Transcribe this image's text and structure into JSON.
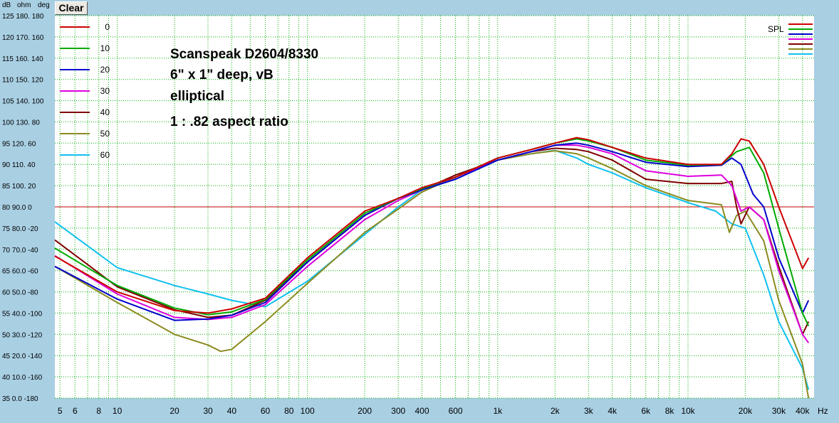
{
  "toolbar": {
    "clear_label": "Clear"
  },
  "header": {
    "unit_db": "dB",
    "unit_ohm": "ohm",
    "unit_deg": "deg"
  },
  "legend_tag": "SPL",
  "x_unit": "Hz",
  "annotation": [
    "Scanspeak D2604/8330",
    "6\" x 1\" deep, vB",
    "elliptical",
    "1 : .82 aspect ratio"
  ],
  "colors": {
    "background": "#ffffff",
    "grid": "#00b000",
    "ref_line": "#c00000",
    "frame": "#a9cfe3"
  },
  "chart_data": {
    "type": "line",
    "x_scale": "log",
    "xlim": [
      4.7,
      46000
    ],
    "ylim": [
      35,
      125
    ],
    "grid": true,
    "legend_position": "top-left",
    "x_tick_labels": [
      "5",
      "6",
      "8",
      "10",
      "20",
      "30",
      "40",
      "60",
      "80",
      "100",
      "200",
      "300",
      "400",
      "600",
      "1k",
      "2k",
      "3k",
      "4k",
      "6k",
      "8k",
      "10k",
      "20k",
      "30k",
      "40k"
    ],
    "y_tick_labels": [
      "125 180. 180",
      "120 170. 160",
      "115 160. 140",
      "110 150. 120",
      "105 140. 100",
      "100 130. 80",
      "95 120. 60",
      "90 110. 40",
      "85 100. 20",
      "80 90.0 0",
      "75 80.0 -20",
      "70 70.0 -40",
      "65 60.0 -60",
      "60 50.0 -80",
      "55 40.0 -100",
      "50 30.0 -120",
      "45 20.0 -140",
      "40 10.0 -160",
      "35 0.0 -180"
    ],
    "reference_line_db": 80,
    "series": [
      {
        "name": "0",
        "color": "#cc0000",
        "points": [
          [
            4.7,
            68.4
          ],
          [
            10,
            60
          ],
          [
            20,
            55.6
          ],
          [
            30,
            55
          ],
          [
            40,
            56
          ],
          [
            60,
            58.5
          ],
          [
            100,
            68
          ],
          [
            200,
            79
          ],
          [
            300,
            82
          ],
          [
            400,
            84.5
          ],
          [
            600,
            87
          ],
          [
            1000,
            91.5
          ],
          [
            1500,
            93.5
          ],
          [
            2000,
            95
          ],
          [
            2600,
            96.3
          ],
          [
            3000,
            95.8
          ],
          [
            4000,
            94
          ],
          [
            6000,
            91.5
          ],
          [
            10000,
            90
          ],
          [
            15000,
            90
          ],
          [
            17000,
            92.5
          ],
          [
            19000,
            96
          ],
          [
            21000,
            95.5
          ],
          [
            25000,
            90
          ],
          [
            30000,
            80
          ],
          [
            40000,
            65.5
          ],
          [
            43000,
            68
          ]
        ]
      },
      {
        "name": "10",
        "color": "#00aa00",
        "points": [
          [
            4.7,
            70.3
          ],
          [
            10,
            61.5
          ],
          [
            20,
            56.2
          ],
          [
            30,
            54.6
          ],
          [
            40,
            55.3
          ],
          [
            60,
            58.2
          ],
          [
            100,
            67.5
          ],
          [
            200,
            78.5
          ],
          [
            300,
            82
          ],
          [
            400,
            84.3
          ],
          [
            600,
            87
          ],
          [
            1000,
            91.5
          ],
          [
            1500,
            93.5
          ],
          [
            2000,
            95
          ],
          [
            2600,
            96
          ],
          [
            3000,
            95.5
          ],
          [
            4000,
            94
          ],
          [
            6000,
            91
          ],
          [
            10000,
            89.8
          ],
          [
            15000,
            90
          ],
          [
            18000,
            93
          ],
          [
            21000,
            94
          ],
          [
            25000,
            88
          ],
          [
            30000,
            75
          ],
          [
            40000,
            55
          ],
          [
            43000,
            52
          ]
        ]
      },
      {
        "name": "20",
        "color": "#0000cc",
        "points": [
          [
            4.7,
            66
          ],
          [
            10,
            58.3
          ],
          [
            20,
            53.3
          ],
          [
            30,
            53.6
          ],
          [
            40,
            54.5
          ],
          [
            60,
            57.5
          ],
          [
            100,
            67
          ],
          [
            200,
            78
          ],
          [
            300,
            82
          ],
          [
            400,
            84
          ],
          [
            600,
            86.5
          ],
          [
            1000,
            91
          ],
          [
            1500,
            93
          ],
          [
            2000,
            94.5
          ],
          [
            2600,
            95
          ],
          [
            3000,
            94.5
          ],
          [
            4000,
            93
          ],
          [
            6000,
            90.5
          ],
          [
            10000,
            89.5
          ],
          [
            15000,
            89.8
          ],
          [
            17000,
            91.5
          ],
          [
            19000,
            90
          ],
          [
            22000,
            83
          ],
          [
            25000,
            80
          ],
          [
            30000,
            68
          ],
          [
            40000,
            55
          ],
          [
            43000,
            58
          ]
        ]
      },
      {
        "name": "30",
        "color": "#dd00dd",
        "points": [
          [
            4.7,
            68.5
          ],
          [
            10,
            59.5
          ],
          [
            20,
            54
          ],
          [
            30,
            53.5
          ],
          [
            40,
            54
          ],
          [
            60,
            57
          ],
          [
            100,
            66
          ],
          [
            200,
            77
          ],
          [
            300,
            81.5
          ],
          [
            400,
            84
          ],
          [
            600,
            87
          ],
          [
            1000,
            91
          ],
          [
            1500,
            93
          ],
          [
            2000,
            94.5
          ],
          [
            2600,
            94.5
          ],
          [
            3000,
            94
          ],
          [
            4000,
            92.5
          ],
          [
            6000,
            88.5
          ],
          [
            10000,
            87.2
          ],
          [
            15000,
            87.5
          ],
          [
            17000,
            85
          ],
          [
            19000,
            79
          ],
          [
            21000,
            80
          ],
          [
            25000,
            77
          ],
          [
            30000,
            65
          ],
          [
            40000,
            50
          ],
          [
            43000,
            48
          ]
        ]
      },
      {
        "name": "40",
        "color": "#800000",
        "points": [
          [
            4.7,
            72.2
          ],
          [
            10,
            61.2
          ],
          [
            20,
            55.8
          ],
          [
            30,
            54
          ],
          [
            40,
            54.5
          ],
          [
            60,
            58
          ],
          [
            100,
            67
          ],
          [
            200,
            78
          ],
          [
            300,
            82
          ],
          [
            400,
            84
          ],
          [
            600,
            87.5
          ],
          [
            1000,
            91
          ],
          [
            1500,
            93
          ],
          [
            2000,
            93.8
          ],
          [
            2600,
            93.5
          ],
          [
            3000,
            93
          ],
          [
            4000,
            91
          ],
          [
            6000,
            86.5
          ],
          [
            10000,
            85.5
          ],
          [
            15000,
            85.5
          ],
          [
            17000,
            86
          ],
          [
            18000,
            80
          ],
          [
            19000,
            76
          ],
          [
            21000,
            80
          ],
          [
            25000,
            77
          ],
          [
            30000,
            66
          ],
          [
            40000,
            50
          ],
          [
            43000,
            53
          ]
        ]
      },
      {
        "name": "50",
        "color": "#8b8b20",
        "points": [
          [
            4.7,
            66
          ],
          [
            10,
            57.5
          ],
          [
            20,
            50
          ],
          [
            30,
            47.5
          ],
          [
            35,
            46
          ],
          [
            40,
            46.5
          ],
          [
            60,
            53
          ],
          [
            100,
            62
          ],
          [
            200,
            74
          ],
          [
            300,
            79.5
          ],
          [
            400,
            83.5
          ],
          [
            600,
            87
          ],
          [
            1000,
            91
          ],
          [
            1500,
            92.5
          ],
          [
            2000,
            93.2
          ],
          [
            2600,
            92.5
          ],
          [
            3000,
            91.5
          ],
          [
            4000,
            89
          ],
          [
            6000,
            85
          ],
          [
            10000,
            81.5
          ],
          [
            15000,
            80.5
          ],
          [
            16500,
            74
          ],
          [
            18000,
            78
          ],
          [
            20000,
            79
          ],
          [
            25000,
            72
          ],
          [
            30000,
            58
          ],
          [
            40000,
            43
          ],
          [
            43000,
            35
          ]
        ]
      },
      {
        "name": "60",
        "color": "#11c0f0",
        "points": [
          [
            4.7,
            76.5
          ],
          [
            10,
            65.7
          ],
          [
            20,
            61.5
          ],
          [
            30,
            59.5
          ],
          [
            40,
            58
          ],
          [
            60,
            56.5
          ],
          [
            100,
            62.5
          ],
          [
            200,
            73.5
          ],
          [
            300,
            80
          ],
          [
            400,
            84
          ],
          [
            600,
            86.5
          ],
          [
            1000,
            91
          ],
          [
            1500,
            92.5
          ],
          [
            2000,
            93.3
          ],
          [
            2600,
            91.5
          ],
          [
            3000,
            90
          ],
          [
            4000,
            88
          ],
          [
            6000,
            84.5
          ],
          [
            10000,
            81
          ],
          [
            14000,
            79
          ],
          [
            17000,
            76
          ],
          [
            20000,
            75
          ],
          [
            25000,
            64
          ],
          [
            30000,
            53
          ],
          [
            40000,
            42
          ],
          [
            43000,
            37
          ]
        ]
      }
    ]
  }
}
